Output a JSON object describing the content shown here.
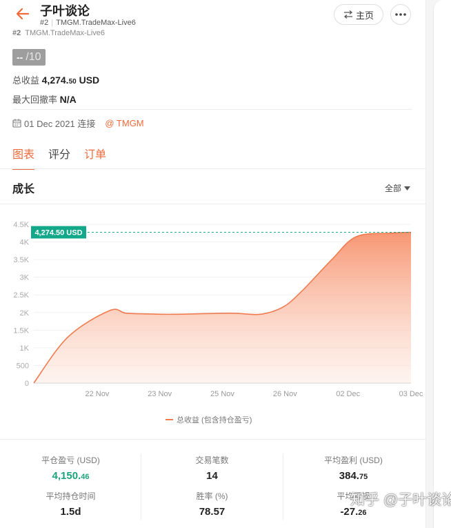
{
  "header": {
    "title": "子叶谈论",
    "rank": "#2",
    "account": "TMGM.TradeMax-Live6",
    "home_label": "主页"
  },
  "account_peek": {
    "rank": "#2",
    "account": "TMGM.TradeMax-Live6"
  },
  "score": {
    "value": "--",
    "denominator": "/10"
  },
  "summary": {
    "total_profit_label": "总收益",
    "total_profit_int": "4,274.",
    "total_profit_dec": "50",
    "total_profit_currency": "USD",
    "max_drawdown_label": "最大回撤率",
    "max_drawdown_value": "N/A"
  },
  "connection": {
    "date_text": "01 Dec 2021 连接",
    "broker": "@ TMGM"
  },
  "tabs": [
    {
      "label": "图表"
    },
    {
      "label": "评分"
    },
    {
      "label": "订单"
    }
  ],
  "growth": {
    "title": "成长",
    "range": "全部"
  },
  "chart_data": {
    "type": "area",
    "x": [
      "20 Nov",
      "21 Nov",
      "22 Nov",
      "22.5 Nov",
      "23 Nov",
      "24 Nov",
      "25 Nov",
      "25.7 Nov",
      "26 Nov",
      "26.5 Nov",
      "27 Nov",
      "01 Dec",
      "02 Dec",
      "03 Dec"
    ],
    "x_tick_labels": [
      "22 Nov",
      "23 Nov",
      "25 Nov",
      "26 Nov",
      "02 Dec",
      "03 Dec"
    ],
    "y_tick_labels": [
      "0",
      "500",
      "1K",
      "1.5K",
      "2K",
      "2.5K",
      "3K",
      "3.5K",
      "4K",
      "4.5K"
    ],
    "values": [
      0,
      1300,
      2050,
      1980,
      1960,
      1950,
      1980,
      1950,
      2150,
      2600,
      3500,
      4150,
      4250,
      4274.5
    ],
    "ylim": [
      0,
      4500
    ],
    "current_value_label": "4,274.50 USD",
    "legend": "总收益 (包含持仓盈亏)",
    "line_color": "#ef7a4e",
    "label_color": "#13a88a"
  },
  "stats": [
    {
      "label": "平仓盈亏 (USD)",
      "value_int": "4,150.",
      "value_dec": "46",
      "green": true
    },
    {
      "label": "交易笔数",
      "value_int": "14",
      "value_dec": "",
      "green": false
    },
    {
      "label": "平均盈利 (USD)",
      "value_int": "384.",
      "value_dec": "75",
      "green": false
    },
    {
      "label": "平均持仓时间",
      "value_int": "1.5d",
      "value_dec": "",
      "green": false
    },
    {
      "label": "胜率 (%)",
      "value_int": "78.57",
      "value_dec": "",
      "green": false
    },
    {
      "label": "平均亏损",
      "value_int": "-27.",
      "value_dec": "26",
      "green": false
    }
  ],
  "watermark": "知乎 @子叶谈论",
  "colors": {
    "accent": "#ef6a3a",
    "green": "#1aa37a"
  }
}
